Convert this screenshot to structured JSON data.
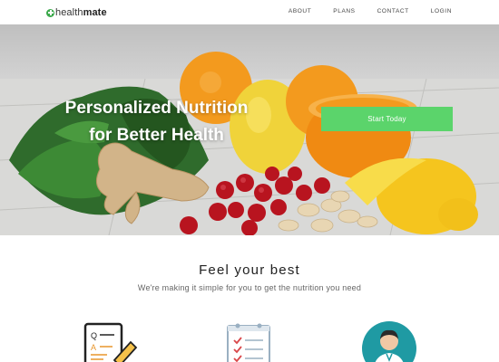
{
  "brand": {
    "prefix": "health",
    "suffix": "mate"
  },
  "nav": {
    "items": [
      "ABOUT",
      "PLANS",
      "CONTACT",
      "LOGIN"
    ]
  },
  "hero": {
    "title_line1": "Personalized Nutrition",
    "title_line2": "for Better Health",
    "cta_label": "Start Today"
  },
  "features": {
    "title": "Feel your best",
    "subtitle": "We're making it simple for you to get the nutrition you need"
  },
  "colors": {
    "accent": "#5bd46b",
    "brand_green": "#3aa84a",
    "doctor_teal": "#1f9aa3"
  }
}
